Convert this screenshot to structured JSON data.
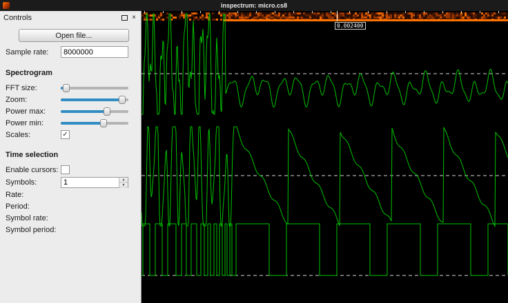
{
  "window": {
    "title": "inspectrum: micro.cs8"
  },
  "controls_panel": {
    "title": "Controls",
    "open_file_button": "Open file...",
    "sample_rate_label": "Sample rate:",
    "sample_rate_value": "8000000",
    "spectrogram": {
      "title": "Spectrogram",
      "fft_size_label": "FFT size:",
      "zoom_label": "Zoom:",
      "power_max_label": "Power max:",
      "power_min_label": "Power min:",
      "scales_label": "Scales:"
    },
    "sliders": {
      "fft_size": 0.03,
      "zoom": 0.95,
      "power_max": 0.7,
      "power_min": 0.65
    },
    "checkboxes": {
      "scales": true,
      "enable_cursors": false
    },
    "time_selection": {
      "title": "Time selection",
      "enable_cursors_label": "Enable cursors:",
      "symbols_label": "Symbols:",
      "symbols_value": "1",
      "rate_label": "Rate:",
      "period_label": "Period:",
      "symbol_rate_label": "Symbol rate:",
      "symbol_period_label": "Symbol period:"
    }
  },
  "plot": {
    "time_tick_label": "0.002400",
    "trace_color": "#00c400",
    "cursor_dash_color": "#ffffff"
  }
}
